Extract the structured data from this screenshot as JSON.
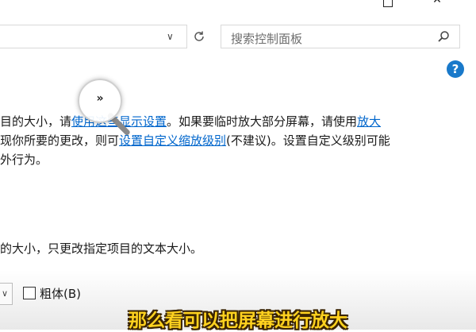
{
  "toolbar": {
    "search_placeholder": "搜索控制面板",
    "refresh_icon": "↻",
    "dropdown_icon": "∨"
  },
  "content": {
    "line1": {
      "a": "目的大小，请",
      "link1": "使用这些显示设置",
      "b": "。如果要临时放大部分屏幕，请使用",
      "link2": "放大"
    },
    "line2": {
      "a": "现你所要的更改，则可",
      "link": "设置自定义缩放级别",
      "b": "(不建议)。设置自定义级别可能"
    },
    "line3": "外行为。",
    "line4": "的大小，只更改指定项目的文本大小。"
  },
  "font_controls": {
    "bold_label": "粗体(B)"
  },
  "magnifier_glyph": "»",
  "subtitle": "那么看可以把屏幕进行放大",
  "help_glyph": "?",
  "colors": {
    "link": "#0066cc",
    "help": "#1979ca",
    "subtitle": "#ffd21f"
  }
}
